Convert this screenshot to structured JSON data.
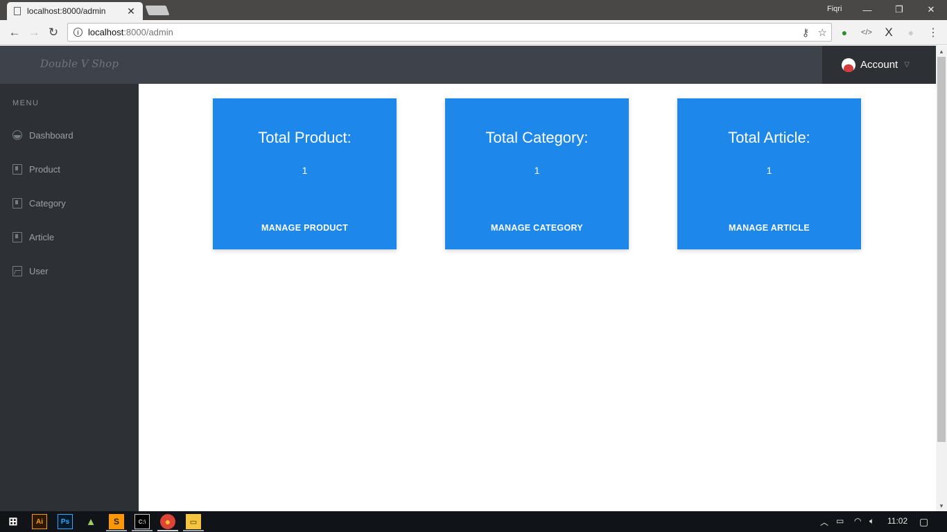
{
  "browser": {
    "tab_title": "localhost:8000/admin",
    "url_host": "localhost",
    "url_rest": ":8000/admin",
    "profile_name": "Fiqri"
  },
  "app": {
    "brand": "Double V Shop",
    "account_label": "Account"
  },
  "sidebar": {
    "menu_heading": "MENU",
    "items": [
      {
        "label": "Dashboard",
        "icon": "dashboard-icon"
      },
      {
        "label": "Product",
        "icon": "document-icon"
      },
      {
        "label": "Category",
        "icon": "document-icon"
      },
      {
        "label": "Article",
        "icon": "document-icon"
      },
      {
        "label": "User",
        "icon": "image-icon"
      }
    ]
  },
  "cards": [
    {
      "title": "Total Product:",
      "value": "1",
      "link": "MANAGE PRODUCT"
    },
    {
      "title": "Total Category:",
      "value": "1",
      "link": "MANAGE CATEGORY"
    },
    {
      "title": "Total Article:",
      "value": "1",
      "link": "MANAGE ARTICLE"
    }
  ],
  "taskbar": {
    "clock": "11:02",
    "apps": [
      "Ai",
      "Ps",
      "android-studio",
      "sublime",
      "cmd",
      "chrome",
      "explorer"
    ]
  },
  "colors": {
    "card_bg": "#1e88ea",
    "sidebar_bg": "#2d3136",
    "header_bg": "#3e434a"
  }
}
